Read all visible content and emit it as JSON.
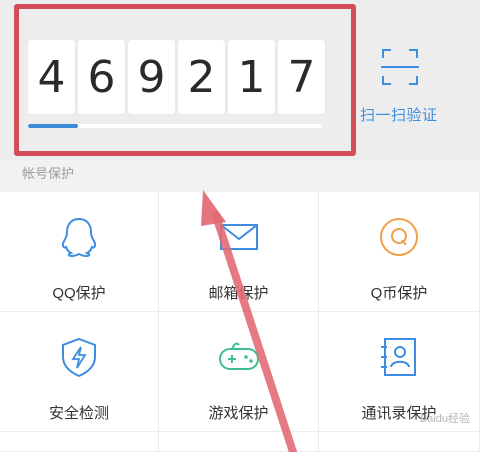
{
  "token": {
    "digits": [
      "4",
      "6",
      "9",
      "2",
      "1",
      "7"
    ],
    "progress_percent": 17
  },
  "scan": {
    "label": "扫一扫验证",
    "icon": "scan-frame-icon"
  },
  "section": {
    "title": "帐号保护"
  },
  "features": [
    {
      "label": "QQ保护",
      "icon": "qq-penguin-icon"
    },
    {
      "label": "邮箱保护",
      "icon": "envelope-icon"
    },
    {
      "label": "Q币保护",
      "icon": "q-coin-icon"
    },
    {
      "label": "安全检测",
      "icon": "lightning-shield-icon"
    },
    {
      "label": "游戏保护",
      "icon": "gamepad-icon"
    },
    {
      "label": "通讯录保护",
      "icon": "contact-book-icon"
    }
  ],
  "colors": {
    "accent": "#3d8ee0",
    "highlight": "#d44d58",
    "arrow": "#e26873"
  },
  "watermark": {
    "text": "Baidu经验"
  }
}
